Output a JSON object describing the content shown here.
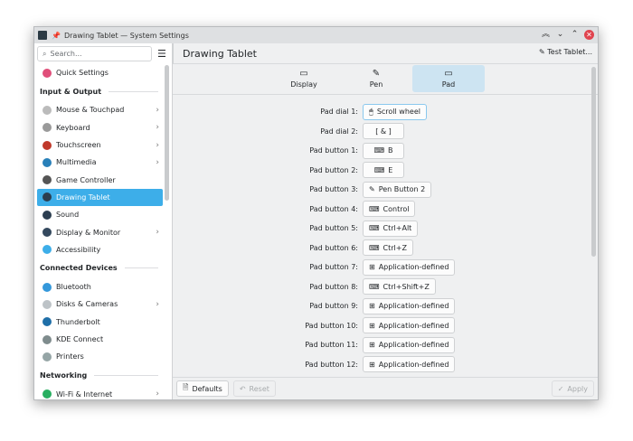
{
  "window": {
    "title": "Drawing Tablet — System Settings"
  },
  "search": {
    "placeholder": "Search..."
  },
  "sidebar": [
    {
      "type": "item",
      "label": "Quick Settings",
      "color": "#e04f7a"
    },
    {
      "type": "header",
      "label": "Input & Output"
    },
    {
      "type": "item",
      "label": "Mouse & Touchpad",
      "color": "#bbbbbb",
      "chev": true
    },
    {
      "type": "item",
      "label": "Keyboard",
      "color": "#9a9a9a",
      "chev": true
    },
    {
      "type": "item",
      "label": "Touchscreen",
      "color": "#c0392b",
      "chev": true
    },
    {
      "type": "item",
      "label": "Multimedia",
      "color": "#2980b9",
      "chev": true
    },
    {
      "type": "item",
      "label": "Game Controller",
      "color": "#555555"
    },
    {
      "type": "item",
      "label": "Drawing Tablet",
      "color": "#2c3e50",
      "selected": true
    },
    {
      "type": "item",
      "label": "Sound",
      "color": "#2c3e50"
    },
    {
      "type": "item",
      "label": "Display & Monitor",
      "color": "#34495e",
      "chev": true
    },
    {
      "type": "item",
      "label": "Accessibility",
      "color": "#3daee9"
    },
    {
      "type": "header",
      "label": "Connected Devices"
    },
    {
      "type": "item",
      "label": "Bluetooth",
      "color": "#3498db"
    },
    {
      "type": "item",
      "label": "Disks & Cameras",
      "color": "#bdc3c7",
      "chev": true
    },
    {
      "type": "item",
      "label": "Thunderbolt",
      "color": "#1f6fa8"
    },
    {
      "type": "item",
      "label": "KDE Connect",
      "color": "#7f8c8d"
    },
    {
      "type": "item",
      "label": "Printers",
      "color": "#95a5a6"
    },
    {
      "type": "header",
      "label": "Networking"
    },
    {
      "type": "item",
      "label": "Wi-Fi & Internet",
      "color": "#27ae60",
      "chev": true
    }
  ],
  "header": {
    "title": "Drawing Tablet",
    "test_label": "Test Tablet..."
  },
  "tabs": [
    {
      "label": "Display",
      "icon": "▭"
    },
    {
      "label": "Pen",
      "icon": "✎"
    },
    {
      "label": "Pad",
      "icon": "▭",
      "selected": true
    }
  ],
  "rows": [
    {
      "label": "Pad dial 1:",
      "value": "Scroll wheel",
      "icon": "🖱",
      "focus": true
    },
    {
      "label": "Pad dial 2:",
      "value": "[ & ]",
      "icon": ""
    },
    {
      "label": "Pad button 1:",
      "value": "B",
      "icon": "⌨"
    },
    {
      "label": "Pad button 2:",
      "value": "E",
      "icon": "⌨"
    },
    {
      "label": "Pad button 3:",
      "value": "Pen Button 2",
      "icon": "✎"
    },
    {
      "label": "Pad button 4:",
      "value": "Control",
      "icon": "⌨"
    },
    {
      "label": "Pad button 5:",
      "value": "Ctrl+Alt",
      "icon": "⌨"
    },
    {
      "label": "Pad button 6:",
      "value": "Ctrl+Z",
      "icon": "⌨"
    },
    {
      "label": "Pad button 7:",
      "value": "Application-defined",
      "icon": "⊞"
    },
    {
      "label": "Pad button 8:",
      "value": "Ctrl+Shift+Z",
      "icon": "⌨"
    },
    {
      "label": "Pad button 9:",
      "value": "Application-defined",
      "icon": "⊞"
    },
    {
      "label": "Pad button 10:",
      "value": "Application-defined",
      "icon": "⊞"
    },
    {
      "label": "Pad button 11:",
      "value": "Application-defined",
      "icon": "⊞"
    },
    {
      "label": "Pad button 12:",
      "value": "Application-defined",
      "icon": "⊞"
    }
  ],
  "footer": {
    "defaults": "Defaults",
    "reset": "Reset",
    "apply": "Apply"
  }
}
